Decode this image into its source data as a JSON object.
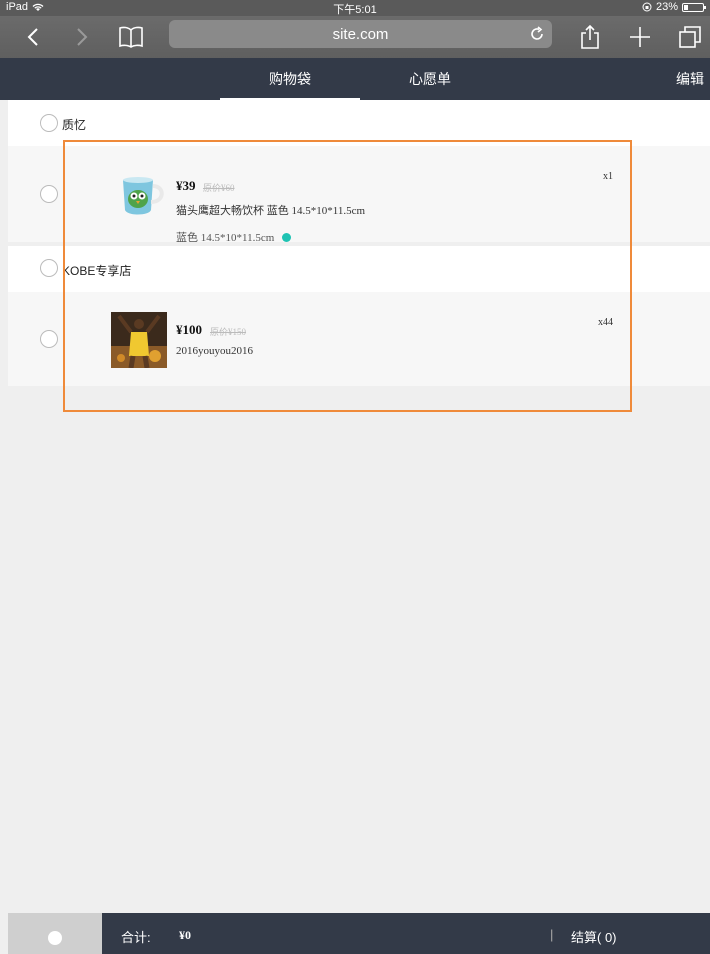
{
  "status_bar": {
    "device": "iPad",
    "time": "下午5:01",
    "battery": "23%"
  },
  "browser": {
    "url": "site.com"
  },
  "tabs": [
    {
      "label": "购物袋",
      "active": true
    },
    {
      "label": "心愿单",
      "active": false
    }
  ],
  "edit_label": "编辑",
  "stores": [
    {
      "name": "质忆",
      "items": [
        {
          "price": "¥39",
          "original": "原价¥60",
          "title": "猫头鹰超大畅饮杯 蓝色 14.5*10*11.5cm",
          "spec": "蓝色 14.5*10*11.5cm",
          "spec_color": "#1fc3b3",
          "qty": "x1"
        }
      ]
    },
    {
      "name": "KOBE专享店",
      "items": [
        {
          "price": "¥100",
          "original": "原价¥150",
          "title": "2016youyou2016",
          "qty": "x44"
        }
      ]
    }
  ],
  "footer": {
    "total_label": "合计:",
    "total_value": "¥0",
    "separator": "|",
    "checkout_label": "结算( 0)"
  },
  "colors": {
    "header_bg": "#333a48",
    "highlight": "#ef8a3a"
  }
}
